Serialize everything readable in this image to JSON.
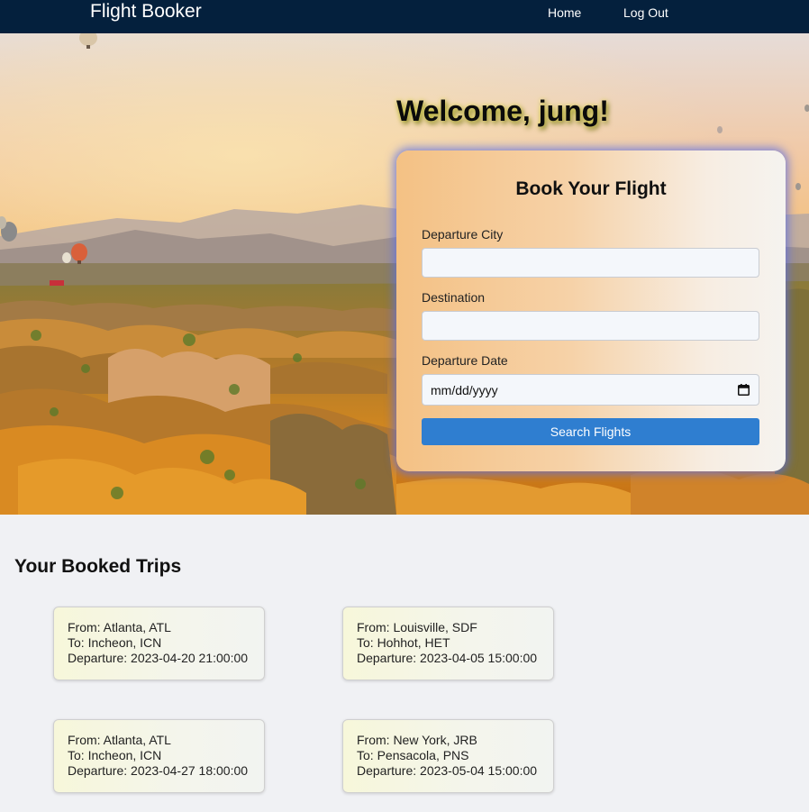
{
  "nav": {
    "brand": "Flight Booker",
    "home": "Home",
    "logout": "Log Out"
  },
  "hero": {
    "welcome": "Welcome, jung!"
  },
  "booking_form": {
    "title": "Book Your Flight",
    "departure_city_label": "Departure City",
    "departure_city_value": "",
    "destination_label": "Destination",
    "destination_value": "",
    "departure_date_label": "Departure Date",
    "departure_date_placeholder": "mm/dd/yyyy",
    "search_button": "Search Flights"
  },
  "trips": {
    "heading": "Your Booked Trips",
    "items": [
      {
        "from": "From: Atlanta, ATL",
        "to": "To: Incheon, ICN",
        "departure": "Departure: 2023-04-20 21:00:00"
      },
      {
        "from": "From: Louisville, SDF",
        "to": "To: Hohhot, HET",
        "departure": "Departure: 2023-04-05 15:00:00"
      },
      {
        "from": "From: Atlanta, ATL",
        "to": "To: Incheon, ICN",
        "departure": "Departure: 2023-04-27 18:00:00"
      },
      {
        "from": "From: New York, JRB",
        "to": "To: Pensacola, PNS",
        "departure": "Departure: 2023-05-04 15:00:00"
      }
    ]
  },
  "colors": {
    "navbar": "#04203d",
    "button": "#2f7ed0",
    "page_background": "#f0f1f4"
  }
}
